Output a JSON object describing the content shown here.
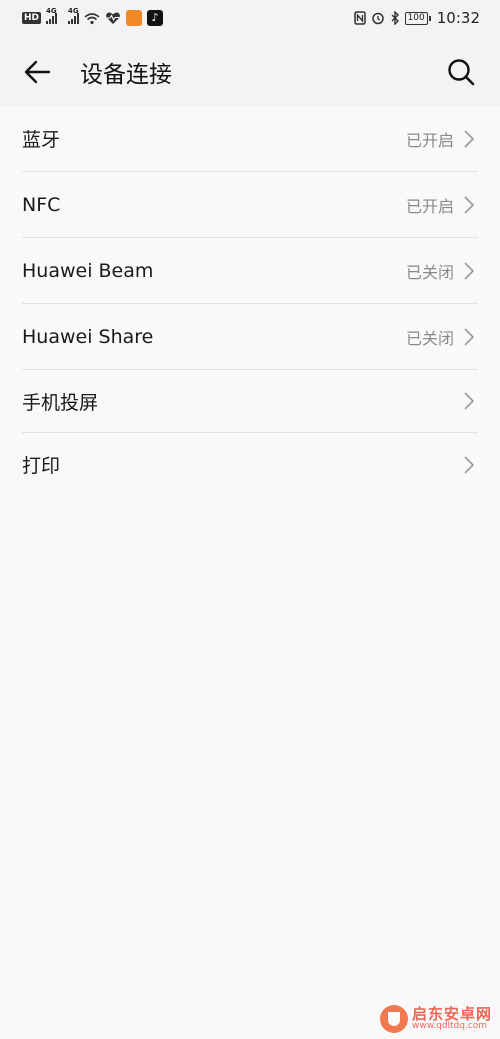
{
  "status_bar": {
    "hd": "HD",
    "sig1": "4G",
    "sig2": "4G",
    "battery": "100",
    "time": "10:32"
  },
  "header": {
    "title": "设备连接"
  },
  "rows": [
    {
      "label": "蓝牙",
      "status": "已开启"
    },
    {
      "label": "NFC",
      "status": "已开启"
    },
    {
      "label": "Huawei Beam",
      "status": "已关闭"
    },
    {
      "label": "Huawei Share",
      "status": "已关闭"
    },
    {
      "label": "手机投屏",
      "status": ""
    },
    {
      "label": "打印",
      "status": ""
    }
  ],
  "watermark": {
    "cn": "启东安卓网",
    "url": "www.qdltdq.com"
  }
}
